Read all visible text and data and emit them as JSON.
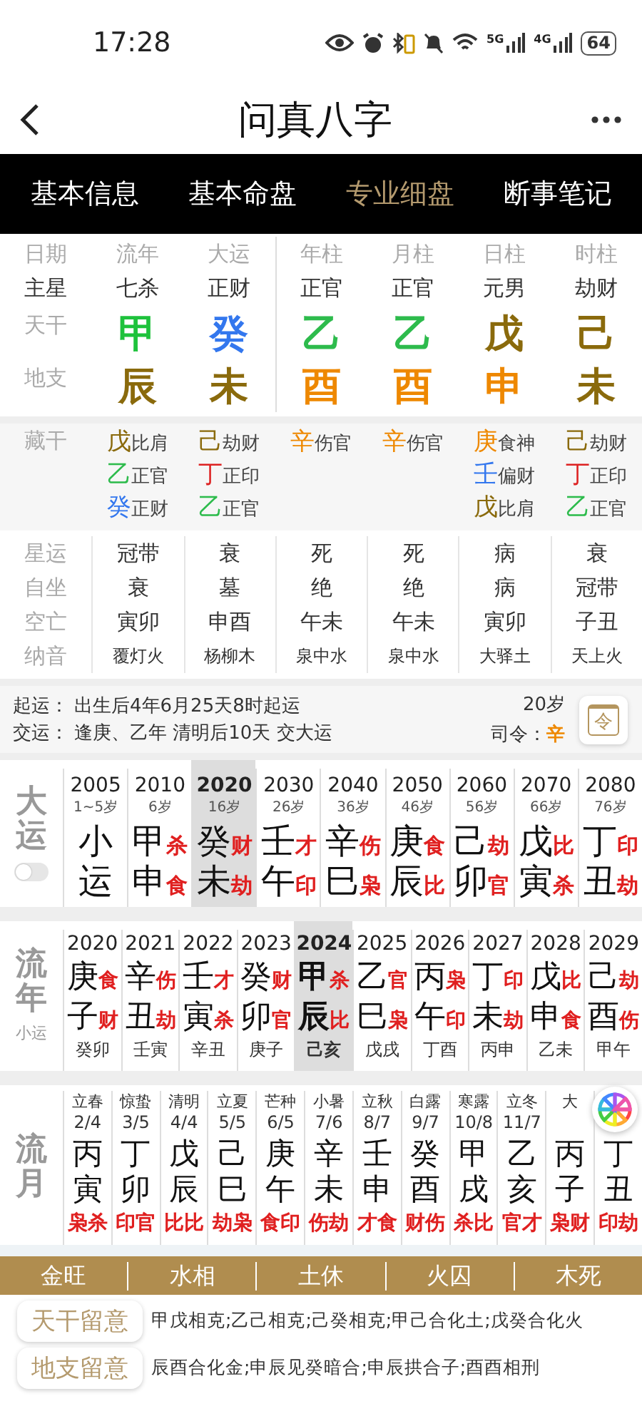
{
  "status_bar": {
    "time": "17:28",
    "signals": [
      "5G",
      "4G"
    ],
    "battery": "64"
  },
  "header": {
    "title": "问真八字"
  },
  "tabs": [
    {
      "label": "基本信息",
      "selected": false
    },
    {
      "label": "基本命盘",
      "selected": false
    },
    {
      "label": "专业细盘",
      "selected": true
    },
    {
      "label": "断事笔记",
      "selected": false
    }
  ],
  "pillars": {
    "corner": "日期",
    "row_labels": [
      "主星",
      "天干",
      "地支"
    ],
    "columns": [
      {
        "heading": "流年",
        "star": "七杀",
        "stem": {
          "char": "甲",
          "color": "#1ec23c"
        },
        "branch": {
          "char": "辰",
          "color": "#8a6a0c"
        }
      },
      {
        "heading": "大运",
        "star": "正财",
        "stem": {
          "char": "癸",
          "color": "#3377ee"
        },
        "branch": {
          "char": "未",
          "color": "#8a6a0c"
        }
      },
      {
        "heading": "年柱",
        "star": "正官",
        "stem": {
          "char": "乙",
          "color": "#2dbb4c"
        },
        "branch": {
          "char": "酉",
          "color": "#ee8800"
        }
      },
      {
        "heading": "月柱",
        "star": "正官",
        "stem": {
          "char": "乙",
          "color": "#2dbb4c"
        },
        "branch": {
          "char": "酉",
          "color": "#ee8800"
        }
      },
      {
        "heading": "日柱",
        "star": "元男",
        "stem": {
          "char": "戊",
          "color": "#8a6a0c"
        },
        "branch": {
          "char": "申",
          "color": "#ee8800"
        }
      },
      {
        "heading": "时柱",
        "star": "劫财",
        "stem": {
          "char": "己",
          "color": "#8a6a0c"
        },
        "branch": {
          "char": "未",
          "color": "#8a6a0c"
        }
      }
    ]
  },
  "hidden_stems": {
    "label": "藏干",
    "columns": [
      [
        {
          "stem": "戊",
          "color": "#8a6a0c",
          "god": "比肩"
        },
        {
          "stem": "乙",
          "color": "#2dbb4c",
          "god": "正官"
        },
        {
          "stem": "癸",
          "color": "#3377ee",
          "god": "正财"
        }
      ],
      [
        {
          "stem": "己",
          "color": "#8a6a0c",
          "god": "劫财"
        },
        {
          "stem": "丁",
          "color": "#dd2222",
          "god": "正印"
        },
        {
          "stem": "乙",
          "color": "#2dbb4c",
          "god": "正官"
        }
      ],
      [
        {
          "stem": "辛",
          "color": "#ee8800",
          "god": "伤官"
        }
      ],
      [
        {
          "stem": "辛",
          "color": "#ee8800",
          "god": "伤官"
        }
      ],
      [
        {
          "stem": "庚",
          "color": "#ee8800",
          "god": "食神"
        },
        {
          "stem": "壬",
          "color": "#3377ee",
          "god": "偏财"
        },
        {
          "stem": "戊",
          "color": "#8a6a0c",
          "god": "比肩"
        }
      ],
      [
        {
          "stem": "己",
          "color": "#8a6a0c",
          "god": "劫财"
        },
        {
          "stem": "丁",
          "color": "#dd2222",
          "god": "正印"
        },
        {
          "stem": "乙",
          "color": "#2dbb4c",
          "god": "正官"
        }
      ]
    ]
  },
  "stats": [
    {
      "label": "星运",
      "values": [
        "冠带",
        "衰",
        "死",
        "死",
        "病",
        "衰"
      ]
    },
    {
      "label": "自坐",
      "values": [
        "衰",
        "墓",
        "绝",
        "绝",
        "病",
        "冠带"
      ]
    },
    {
      "label": "空亡",
      "values": [
        "寅卯",
        "申酉",
        "午未",
        "午未",
        "寅卯",
        "子丑"
      ]
    },
    {
      "label": "纳音",
      "values": [
        "覆灯火",
        "杨柳木",
        "泉中水",
        "泉中水",
        "大驿土",
        "天上火"
      ]
    }
  ],
  "luck_info": {
    "lines": [
      {
        "label": "起运：",
        "text": "出生后4年6月25天8时起运"
      },
      {
        "label": "交运：",
        "text": "逢庚、乙年 清明后10天 交大运"
      }
    ],
    "age": "20岁",
    "commander_label": "司令：",
    "commander": "辛",
    "badge": "令"
  },
  "dayun": {
    "label": "大运",
    "toggle_on": false,
    "columns": [
      {
        "year": "2005",
        "age": "1~5岁",
        "stem": "小",
        "branch": "运",
        "selected": false
      },
      {
        "year": "2010",
        "age": "6岁",
        "stem": "甲",
        "stem_god": "杀",
        "branch": "申",
        "branch_god": "食",
        "selected": false
      },
      {
        "year": "2020",
        "age": "16岁",
        "stem": "癸",
        "stem_god": "财",
        "branch": "未",
        "branch_god": "劫",
        "selected": true
      },
      {
        "year": "2030",
        "age": "26岁",
        "stem": "壬",
        "stem_god": "才",
        "branch": "午",
        "branch_god": "印",
        "selected": false
      },
      {
        "year": "2040",
        "age": "36岁",
        "stem": "辛",
        "stem_god": "伤",
        "branch": "巳",
        "branch_god": "枭",
        "selected": false
      },
      {
        "year": "2050",
        "age": "46岁",
        "stem": "庚",
        "stem_god": "食",
        "branch": "辰",
        "branch_god": "比",
        "selected": false
      },
      {
        "year": "2060",
        "age": "56岁",
        "stem": "己",
        "stem_god": "劫",
        "branch": "卯",
        "branch_god": "官",
        "selected": false
      },
      {
        "year": "2070",
        "age": "66岁",
        "stem": "戊",
        "stem_god": "比",
        "branch": "寅",
        "branch_god": "杀",
        "selected": false
      },
      {
        "year": "2080",
        "age": "76岁",
        "stem": "丁",
        "stem_god": "印",
        "branch": "丑",
        "branch_god": "劫",
        "selected": false
      }
    ]
  },
  "liunian": {
    "label": "流年",
    "sublabel": "小运",
    "columns": [
      {
        "year": "2020",
        "stem": "庚",
        "stem_god": "食",
        "branch": "子",
        "branch_god": "财",
        "xiaoyun": "癸卯",
        "selected": false
      },
      {
        "year": "2021",
        "stem": "辛",
        "stem_god": "伤",
        "branch": "丑",
        "branch_god": "劫",
        "xiaoyun": "壬寅",
        "selected": false
      },
      {
        "year": "2022",
        "stem": "壬",
        "stem_god": "才",
        "branch": "寅",
        "branch_god": "杀",
        "xiaoyun": "辛丑",
        "selected": false
      },
      {
        "year": "2023",
        "stem": "癸",
        "stem_god": "财",
        "branch": "卯",
        "branch_god": "官",
        "xiaoyun": "庚子",
        "selected": false
      },
      {
        "year": "2024",
        "stem": "甲",
        "stem_god": "杀",
        "branch": "辰",
        "branch_god": "比",
        "xiaoyun": "己亥",
        "selected": true
      },
      {
        "year": "2025",
        "stem": "乙",
        "stem_god": "官",
        "branch": "巳",
        "branch_god": "枭",
        "xiaoyun": "戊戌",
        "selected": false
      },
      {
        "year": "2026",
        "stem": "丙",
        "stem_god": "枭",
        "branch": "午",
        "branch_god": "印",
        "xiaoyun": "丁酉",
        "selected": false
      },
      {
        "year": "2027",
        "stem": "丁",
        "stem_god": "印",
        "branch": "未",
        "branch_god": "劫",
        "xiaoyun": "丙申",
        "selected": false
      },
      {
        "year": "2028",
        "stem": "戊",
        "stem_god": "比",
        "branch": "申",
        "branch_god": "食",
        "xiaoyun": "乙未",
        "selected": false
      },
      {
        "year": "2029",
        "stem": "己",
        "stem_god": "劫",
        "branch": "酉",
        "branch_god": "伤",
        "xiaoyun": "甲午",
        "selected": false
      }
    ]
  },
  "liuyue": {
    "label": "流月",
    "columns": [
      {
        "term": "立春",
        "date": "2/4",
        "stem": "丙",
        "branch": "寅",
        "gods": "枭杀"
      },
      {
        "term": "惊蛰",
        "date": "3/5",
        "stem": "丁",
        "branch": "卯",
        "gods": "印官"
      },
      {
        "term": "清明",
        "date": "4/4",
        "stem": "戊",
        "branch": "辰",
        "gods": "比比"
      },
      {
        "term": "立夏",
        "date": "5/5",
        "stem": "己",
        "branch": "巳",
        "gods": "劫枭"
      },
      {
        "term": "芒种",
        "date": "6/5",
        "stem": "庚",
        "branch": "午",
        "gods": "食印"
      },
      {
        "term": "小暑",
        "date": "7/6",
        "stem": "辛",
        "branch": "未",
        "gods": "伤劫"
      },
      {
        "term": "立秋",
        "date": "8/7",
        "stem": "壬",
        "branch": "申",
        "gods": "才食"
      },
      {
        "term": "白露",
        "date": "9/7",
        "stem": "癸",
        "branch": "酉",
        "gods": "财伤"
      },
      {
        "term": "寒露",
        "date": "10/8",
        "stem": "甲",
        "branch": "戌",
        "gods": "杀比"
      },
      {
        "term": "立冬",
        "date": "11/7",
        "stem": "乙",
        "branch": "亥",
        "gods": "官才"
      },
      {
        "term": "大",
        "stem": "丙",
        "branch": "子",
        "gods": "枭财"
      },
      {
        "stem": "丁",
        "branch": "丑",
        "gods": "印劫"
      }
    ]
  },
  "elements": [
    "金旺",
    "水相",
    "土休",
    "火囚",
    "木死"
  ],
  "notes": [
    {
      "label": "天干留意",
      "text": "甲戊相克;乙己相克;己癸相克;甲己合化土;戊癸合化火"
    },
    {
      "label": "地支留意",
      "text": "辰酉合化金;申辰见癸暗合;申辰拱合子;酉酉相刑"
    }
  ]
}
